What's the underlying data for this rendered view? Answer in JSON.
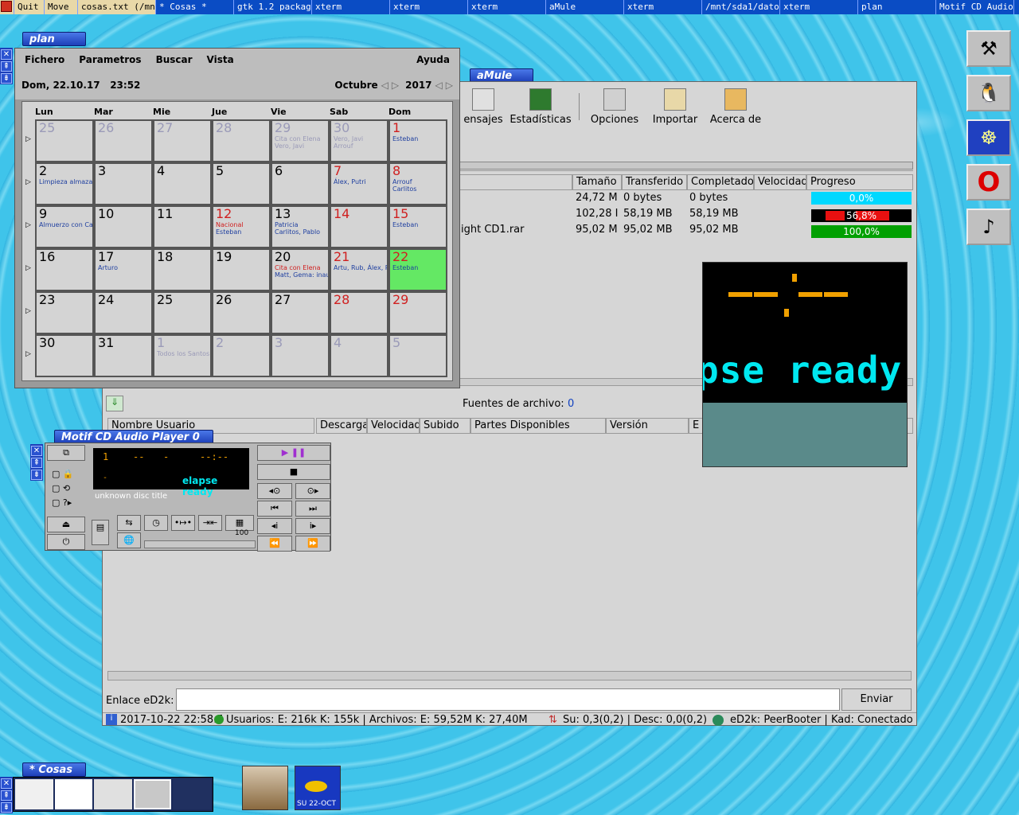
{
  "taskbar": {
    "items": [
      "Quit",
      "Move",
      "cosas.txt (/mnt",
      "* Cosas *",
      "gtk 1.2 package",
      "xterm",
      "xterm",
      "xterm",
      "aMule",
      "xterm",
      "/mnt/sda1/datos",
      "xterm",
      "plan",
      "Motif CD Audio P"
    ]
  },
  "plan": {
    "tab_title": "plan",
    "menu": [
      "Fichero",
      "Parametros",
      "Buscar",
      "Vista"
    ],
    "help": "Ayuda",
    "datetime": "Dom, 22.10.17   23:52",
    "month": "Octubre",
    "year": "2017",
    "weekdays": [
      "Lun",
      "Mar",
      "Mie",
      "Jue",
      "Vie",
      "Sab",
      "Dom"
    ],
    "weeks": [
      [
        {
          "n": "25",
          "dim": true
        },
        {
          "n": "26",
          "dim": true
        },
        {
          "n": "27",
          "dim": true
        },
        {
          "n": "28",
          "dim": true
        },
        {
          "n": "29",
          "dim": true,
          "ev": [
            "Cita con Elena",
            "Vero, Javi"
          ]
        },
        {
          "n": "30",
          "dim": true,
          "ev": [
            "Vero, Javi",
            "Arrouf"
          ]
        },
        {
          "n": "1",
          "red": true,
          "ev": [
            "Esteban"
          ]
        }
      ],
      [
        {
          "n": "2",
          "ev": [
            "Limpieza almazara"
          ]
        },
        {
          "n": "3"
        },
        {
          "n": "4"
        },
        {
          "n": "5"
        },
        {
          "n": "6"
        },
        {
          "n": "7",
          "red": true,
          "ev": [
            "Álex, Putri"
          ]
        },
        {
          "n": "8",
          "red": true,
          "ev": [
            "Arrouf",
            "Carlitos"
          ]
        }
      ],
      [
        {
          "n": "9",
          "ev": [
            "Almuerzo con Carli"
          ]
        },
        {
          "n": "10"
        },
        {
          "n": "11"
        },
        {
          "n": "12",
          "red": true,
          "ev": [
            "Nacional",
            "Esteban"
          ]
        },
        {
          "n": "13",
          "ev": [
            "Patricia",
            "Carlitos, Pablo"
          ]
        },
        {
          "n": "14",
          "red": true
        },
        {
          "n": "15",
          "red": true,
          "ev": [
            "Esteban"
          ]
        }
      ],
      [
        {
          "n": "16"
        },
        {
          "n": "17",
          "ev": [
            "Arturo"
          ]
        },
        {
          "n": "18"
        },
        {
          "n": "19"
        },
        {
          "n": "20",
          "ev": [
            "Cita con Elena",
            "Matt, Gema: inaug."
          ]
        },
        {
          "n": "21",
          "red": true,
          "ev": [
            "Artu, Rub, Álex, P"
          ]
        },
        {
          "n": "22",
          "red": true,
          "today": true,
          "ev": [
            "Esteban"
          ]
        }
      ],
      [
        {
          "n": "23"
        },
        {
          "n": "24"
        },
        {
          "n": "25"
        },
        {
          "n": "26"
        },
        {
          "n": "27"
        },
        {
          "n": "28",
          "red": true
        },
        {
          "n": "29",
          "red": true
        }
      ],
      [
        {
          "n": "30"
        },
        {
          "n": "31"
        },
        {
          "n": "1",
          "dim": true,
          "ev": [
            "Todos los Santos"
          ]
        },
        {
          "n": "2",
          "dim": true
        },
        {
          "n": "3",
          "dim": true
        },
        {
          "n": "4",
          "dim": true
        },
        {
          "n": "5",
          "dim": true
        }
      ]
    ]
  },
  "amule": {
    "tab_title": "aMule",
    "toolbar": [
      "ensajes",
      "Estadísticas",
      "Opciones",
      "Importar",
      "Acerca de"
    ],
    "columns": [
      "Tamaño",
      "Transferido",
      "Completado",
      "Velocidad",
      "Progreso"
    ],
    "rows": [
      {
        "name": "",
        "size": "24,72 M",
        "transf": "0 bytes",
        "compl": "0 bytes",
        "progress": "0,0%",
        "pct": 0.0
      },
      {
        "name": "",
        "size": "102,28 I",
        "transf": "58,19 MB",
        "compl": "58,19 MB",
        "progress": "56,8%",
        "pct": 0.568
      },
      {
        "name": "ight CD1.rar",
        "size": "95,02 M",
        "transf": "95,02 MB",
        "compl": "95,02 MB",
        "progress": "100,0%",
        "pct": 1.0
      }
    ],
    "sources_label": "Fuentes de archivo:",
    "sources_count": "0",
    "src_columns": [
      "Nombre Usuario",
      "Descarga",
      "Velocidad",
      "Subido",
      "Partes Disponibles",
      "Versión",
      "E"
    ],
    "ed2k_label": "Enlace eD2k:",
    "ed2k_value": "",
    "send": "Enviar",
    "status": {
      "time": "2017-10-22 22:58:5",
      "users": "Usuarios: E: 216k K: 155k | Archivos: E: 59,52M K: 27,40M",
      "rates": "Su: 0,3(0,2) | Desc: 0,0(0,2)",
      "net": "eD2k: PeerBooter | Kad: Conectado"
    }
  },
  "cd": {
    "tab_title": "Motif CD Audio Player 0",
    "track": "1",
    "time1": "--",
    "time2": "-",
    "time3": "--:--",
    "dash": "-",
    "status": "elapse ready",
    "disc_title": "unknown disc title",
    "volume_label": "100"
  },
  "overlay": {
    "text": "pse ready"
  },
  "cosas": {
    "tab_title": "* Cosas *"
  },
  "clock": {
    "text": "SU 22-OCT"
  },
  "colors": {
    "accent": "#1d3fb8",
    "progress_cyan": "#00d8ff",
    "progress_green": "#00a000",
    "today": "#64e864",
    "overlay_text": "#00e8f0"
  }
}
